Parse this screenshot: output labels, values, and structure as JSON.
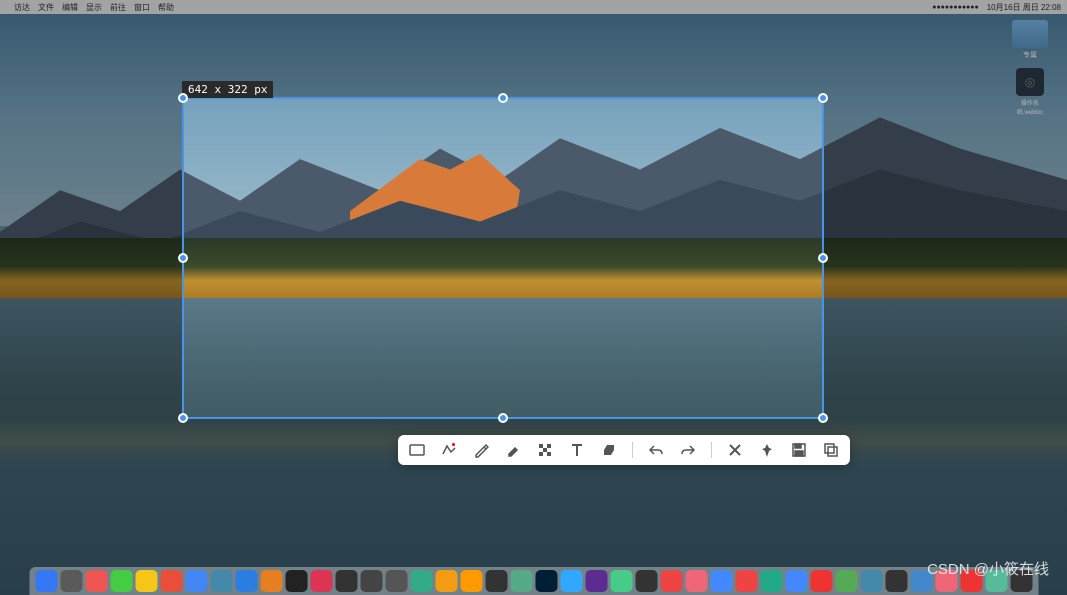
{
  "menubar": {
    "apple": "",
    "items": [
      "访达",
      "文件",
      "编辑",
      "显示",
      "前往",
      "窗口",
      "帮助"
    ],
    "clock": "10月16日 周日 22:08"
  },
  "desktop": {
    "folder_label": "专属",
    "file_label": "操作系统.webloc"
  },
  "selection": {
    "size_text": "642 x 322  px"
  },
  "toolbar": {
    "tools": [
      "rectangle",
      "polyline",
      "pen",
      "marker",
      "mosaic",
      "text",
      "eraser",
      "undo",
      "redo",
      "cancel",
      "pin",
      "save",
      "copy"
    ]
  },
  "dock": {
    "items": [
      {
        "c": "#3478f6"
      },
      {
        "c": "#5a5a5a"
      },
      {
        "c": "#e55"
      },
      {
        "c": "#4c4"
      },
      {
        "c": "#f5c518"
      },
      {
        "c": "#e94e3a"
      },
      {
        "c": "#4285f4"
      },
      {
        "c": "#48a"
      },
      {
        "c": "#2a7de1"
      },
      {
        "c": "#e67e22"
      },
      {
        "c": "#222"
      },
      {
        "c": "#d35"
      },
      {
        "c": "#333"
      },
      {
        "c": "#444"
      },
      {
        "c": "#555"
      },
      {
        "c": "#3a8"
      },
      {
        "c": "#f39c12"
      },
      {
        "c": "#f90"
      },
      {
        "c": "#333"
      },
      {
        "c": "#5a8"
      },
      {
        "c": "#001e36"
      },
      {
        "c": "#31a8ff"
      },
      {
        "c": "#5c2d91"
      },
      {
        "c": "#4c8"
      },
      {
        "c": "#333"
      },
      {
        "c": "#e44"
      },
      {
        "c": "#e67"
      },
      {
        "c": "#48f"
      },
      {
        "c": "#e44"
      },
      {
        "c": "#2a8"
      },
      {
        "c": "#48f"
      },
      {
        "c": "#e33"
      },
      {
        "c": "#5a5"
      },
      {
        "c": "#48a"
      },
      {
        "c": "#333"
      },
      {
        "c": "#48c"
      },
      {
        "c": "#e67"
      },
      {
        "c": "#e33"
      },
      {
        "c": "#5b9"
      },
      {
        "c": "#333"
      }
    ]
  },
  "watermark": "CSDN @小筱在线"
}
